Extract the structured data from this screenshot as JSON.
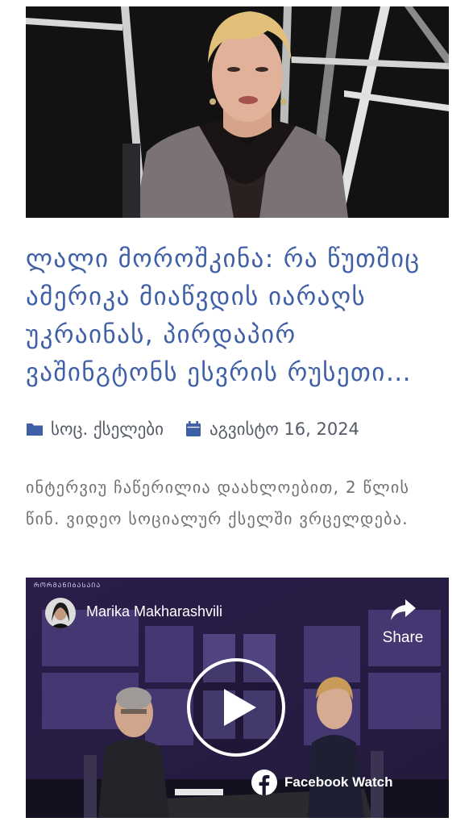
{
  "article": {
    "hero_image": "woman-in-grey-blazer-tv-studio",
    "title": "ლალი მოროშკინა: რა წუთშიც ამერიკა მიაწვდის იარაღს უკრაინას, პირდაპირ ვაშინგტონს ესვრის რუსეთი…",
    "category": "სოც. ქსელები",
    "date": "აგვისტო 16, 2024",
    "excerpt": "ინტერვიუ ჩაწერილია დაახლოებით, 2 წლის წინ. ვიდეო სოციალურ ქსელში ვრცელდება."
  },
  "icons": {
    "category": "folder-icon",
    "date": "calendar-icon"
  },
  "video": {
    "author": "Marika Makharashvili",
    "share_label": "Share",
    "badge_label": "Facebook Watch",
    "studio_tag": "ᲠᲝᲠᲛᲐᲜᲘᲑᲐᲡᲐᲘᲐ"
  },
  "colors": {
    "title": "#3f5fa6",
    "meta_icon": "#3f5fa6",
    "meta_text": "#555b66",
    "excerpt": "#6f6f75",
    "video_bg": "#1b1330"
  }
}
